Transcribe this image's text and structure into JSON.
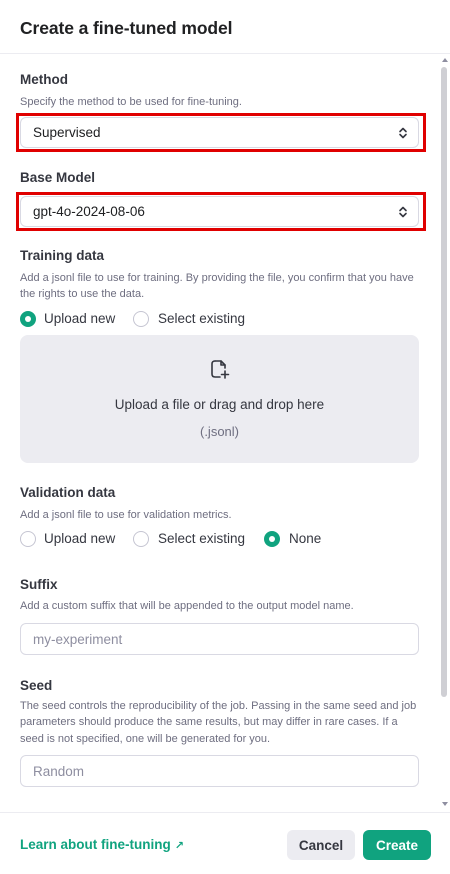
{
  "dialog": {
    "title": "Create a fine-tuned model"
  },
  "method": {
    "label": "Method",
    "hint": "Specify the method to be used for fine-tuning.",
    "value": "Supervised"
  },
  "base_model": {
    "label": "Base Model",
    "value": "gpt-4o-2024-08-06"
  },
  "training_data": {
    "label": "Training data",
    "hint": "Add a jsonl file to use for training. By providing the file, you confirm that you have the rights to use the data.",
    "options": [
      "Upload new",
      "Select existing"
    ],
    "selected": "Upload new",
    "dropzone_text": "Upload a file or drag and drop here",
    "dropzone_sub": "(.jsonl)"
  },
  "validation_data": {
    "label": "Validation data",
    "hint": "Add a jsonl file to use for validation metrics.",
    "options": [
      "Upload new",
      "Select existing",
      "None"
    ],
    "selected": "None"
  },
  "suffix": {
    "label": "Suffix",
    "hint": "Add a custom suffix that will be appended to the output model name.",
    "placeholder": "my-experiment",
    "value": ""
  },
  "seed": {
    "label": "Seed",
    "hint": "The seed controls the reproducibility of the job. Passing in the same seed and job parameters should produce the same results, but may differ in rare cases. If a seed is not specified, one will be generated for you.",
    "placeholder": "Random",
    "value": ""
  },
  "footer": {
    "learn_link": "Learn about fine-tuning",
    "cancel_label": "Cancel",
    "create_label": "Create"
  },
  "colors": {
    "accent": "#10a37f",
    "highlight_border": "#e00000",
    "dropzone_bg": "#ececf1"
  },
  "icons": {
    "select_chevron": "chevron-up-down-icon",
    "upload": "file-plus-icon",
    "external_link": "arrow-up-right-icon"
  }
}
